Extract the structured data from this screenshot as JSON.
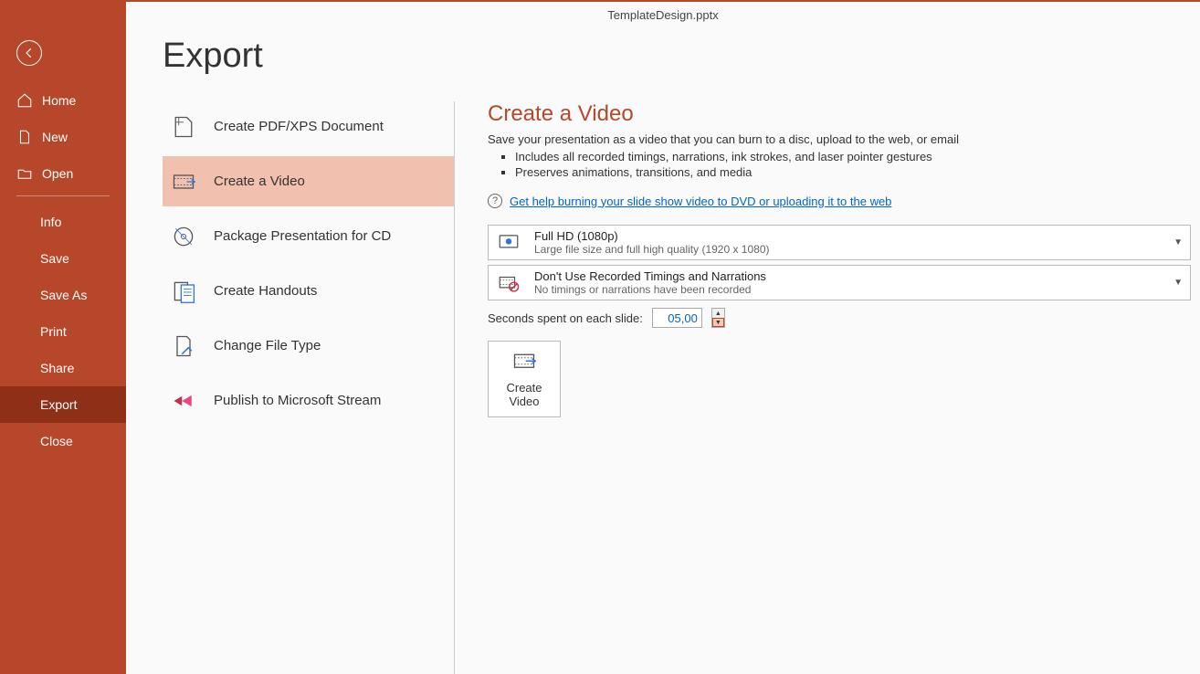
{
  "window": {
    "title": "TemplateDesign.pptx"
  },
  "page": {
    "title": "Export"
  },
  "sidebar": {
    "groups": [
      [
        {
          "label": "Home",
          "icon": "home-icon"
        },
        {
          "label": "New",
          "icon": "new-doc-icon"
        },
        {
          "label": "Open",
          "icon": "open-folder-icon"
        }
      ],
      [
        {
          "label": "Info"
        },
        {
          "label": "Save"
        },
        {
          "label": "Save As"
        },
        {
          "label": "Print"
        },
        {
          "label": "Share"
        },
        {
          "label": "Export",
          "active": true
        },
        {
          "label": "Close"
        }
      ]
    ]
  },
  "export_options": [
    {
      "label": "Create PDF/XPS Document",
      "icon": "pdf-icon"
    },
    {
      "label": "Create a Video",
      "icon": "video-icon",
      "selected": true
    },
    {
      "label": "Package Presentation for CD",
      "icon": "cd-icon"
    },
    {
      "label": "Create Handouts",
      "icon": "handouts-icon"
    },
    {
      "label": "Change File Type",
      "icon": "filetype-icon"
    },
    {
      "label": "Publish to Microsoft Stream",
      "icon": "stream-icon"
    }
  ],
  "detail": {
    "title": "Create a Video",
    "subtitle": "Save your presentation as a video that you can burn to a disc, upload to the web, or email",
    "bullets": [
      "Includes all recorded timings, narrations, ink strokes, and laser pointer gestures",
      "Preserves animations, transitions, and media"
    ],
    "help_link": "Get help burning your slide show video to DVD or uploading it to the web",
    "quality": {
      "title": "Full HD (1080p)",
      "desc": "Large file size and full high quality (1920 x 1080)"
    },
    "timings": {
      "title": "Don't Use Recorded Timings and Narrations",
      "desc": "No timings or narrations have been recorded"
    },
    "seconds_label": "Seconds spent on each slide:",
    "seconds_value": "05,00",
    "create_button_l1": "Create",
    "create_button_l2": "Video"
  }
}
